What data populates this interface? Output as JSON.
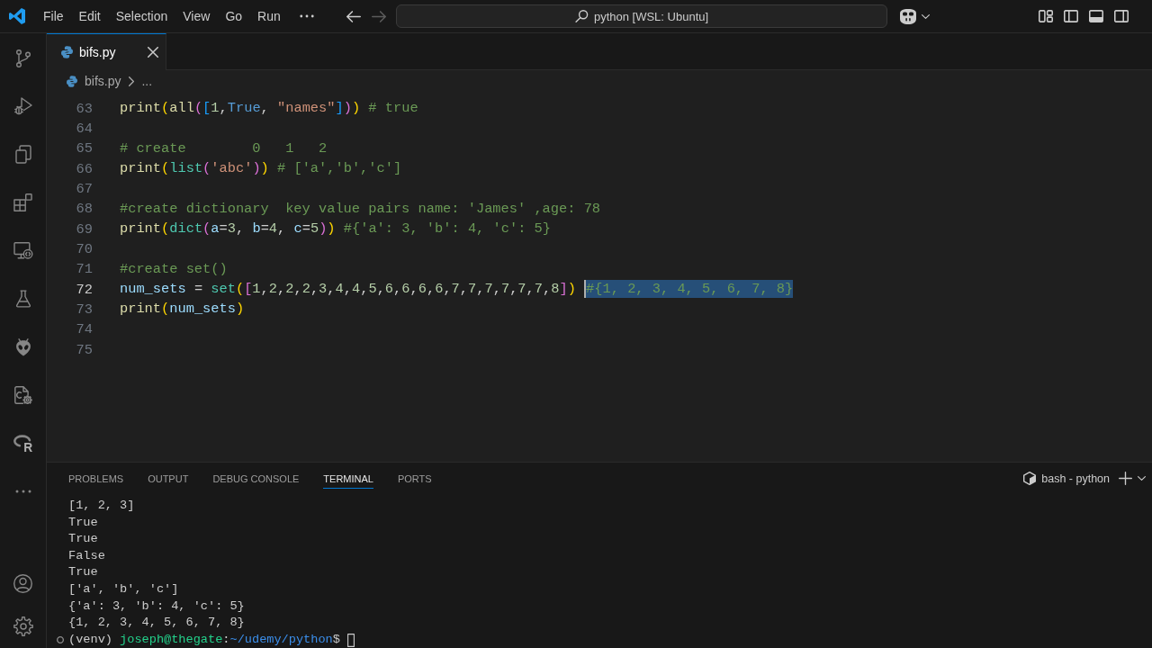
{
  "title_bar": {
    "menu": [
      {
        "label": "File"
      },
      {
        "label": "Edit"
      },
      {
        "label": "Selection"
      },
      {
        "label": "View"
      },
      {
        "label": "Go"
      },
      {
        "label": "Run"
      }
    ],
    "navigation": [
      {
        "kind": "back",
        "disabled": false
      },
      {
        "kind": "forward",
        "disabled": true
      }
    ],
    "command_center": {
      "text": "python [WSL: Ubuntu]"
    },
    "layout_toggles": [
      {
        "kind": "primary_sidebar",
        "on": false
      },
      {
        "kind": "panel",
        "on": true
      },
      {
        "kind": "secondary_sidebar",
        "on": false
      }
    ]
  },
  "activity_bar": {
    "logo_letter": "R"
  },
  "editor": {
    "tabs": [
      {
        "label": "bifs.py",
        "selected": true
      }
    ],
    "breadcrumb": [
      {
        "label": "bifs.py"
      },
      {
        "label": "..."
      }
    ],
    "lines": [
      {
        "number": "63",
        "current": false,
        "tokens": [
          {
            "kind": "function",
            "text": "print"
          },
          {
            "kind": "bracket1",
            "text": "("
          },
          {
            "kind": "function",
            "text": "all"
          },
          {
            "kind": "bracket2",
            "text": "("
          },
          {
            "kind": "bracket3",
            "text": "["
          },
          {
            "kind": "number",
            "text": "1"
          },
          {
            "kind": "text",
            "text": ","
          },
          {
            "kind": "constant",
            "text": "True"
          },
          {
            "kind": "text",
            "text": ", "
          },
          {
            "kind": "string",
            "text": "\"names\""
          },
          {
            "kind": "bracket3",
            "text": "]"
          },
          {
            "kind": "bracket2",
            "text": ")"
          },
          {
            "kind": "bracket1",
            "text": ")"
          },
          {
            "kind": "comment",
            "text": " # true"
          }
        ]
      },
      {
        "number": "64",
        "current": false
      },
      {
        "number": "65",
        "current": false,
        "tokens": [
          {
            "kind": "comment",
            "text": "# create        0   1   2"
          }
        ]
      },
      {
        "number": "66",
        "current": false,
        "tokens": [
          {
            "kind": "function",
            "text": "print"
          },
          {
            "kind": "bracket1",
            "text": "("
          },
          {
            "kind": "class",
            "text": "list"
          },
          {
            "kind": "bracket2",
            "text": "("
          },
          {
            "kind": "string",
            "text": "'abc'"
          },
          {
            "kind": "bracket2",
            "text": ")"
          },
          {
            "kind": "bracket1",
            "text": ")"
          },
          {
            "kind": "comment",
            "text": " # ['a','b','c']"
          }
        ]
      },
      {
        "number": "67",
        "current": false
      },
      {
        "number": "68",
        "current": false,
        "tokens": [
          {
            "kind": "comment",
            "text": "#create dictionary  key value pairs name: 'James' ,age: 78"
          }
        ]
      },
      {
        "number": "69",
        "current": false,
        "tokens": [
          {
            "kind": "function",
            "text": "print"
          },
          {
            "kind": "bracket1",
            "text": "("
          },
          {
            "kind": "class",
            "text": "dict"
          },
          {
            "kind": "bracket2",
            "text": "("
          },
          {
            "kind": "variable",
            "text": "a"
          },
          {
            "kind": "text",
            "text": "="
          },
          {
            "kind": "number",
            "text": "3"
          },
          {
            "kind": "text",
            "text": ", "
          },
          {
            "kind": "variable",
            "text": "b"
          },
          {
            "kind": "text",
            "text": "="
          },
          {
            "kind": "number",
            "text": "4"
          },
          {
            "kind": "text",
            "text": ", "
          },
          {
            "kind": "variable",
            "text": "c"
          },
          {
            "kind": "text",
            "text": "="
          },
          {
            "kind": "number",
            "text": "5"
          },
          {
            "kind": "bracket2",
            "text": ")"
          },
          {
            "kind": "bracket1",
            "text": ")"
          },
          {
            "kind": "comment",
            "text": " #{'a': 3, 'b': 4, 'c': 5}"
          }
        ]
      },
      {
        "number": "70",
        "current": false
      },
      {
        "number": "71",
        "current": false,
        "tokens": [
          {
            "kind": "comment",
            "text": "#create set()"
          }
        ]
      },
      {
        "number": "72",
        "current": true,
        "tokens": [
          {
            "kind": "variable",
            "text": "num_sets"
          },
          {
            "kind": "text",
            "text": " = "
          },
          {
            "kind": "class",
            "text": "set"
          },
          {
            "kind": "bracket1",
            "text": "("
          },
          {
            "kind": "bracket2",
            "text": "["
          },
          {
            "kind": "number",
            "text": "1"
          },
          {
            "kind": "text",
            "text": ","
          },
          {
            "kind": "number",
            "text": "2"
          },
          {
            "kind": "text",
            "text": ","
          },
          {
            "kind": "number",
            "text": "2"
          },
          {
            "kind": "text",
            "text": ","
          },
          {
            "kind": "number",
            "text": "2"
          },
          {
            "kind": "text",
            "text": ","
          },
          {
            "kind": "number",
            "text": "3"
          },
          {
            "kind": "text",
            "text": ","
          },
          {
            "kind": "number",
            "text": "4"
          },
          {
            "kind": "text",
            "text": ","
          },
          {
            "kind": "number",
            "text": "4"
          },
          {
            "kind": "text",
            "text": ","
          },
          {
            "kind": "number",
            "text": "5"
          },
          {
            "kind": "text",
            "text": ","
          },
          {
            "kind": "number",
            "text": "6"
          },
          {
            "kind": "text",
            "text": ","
          },
          {
            "kind": "number",
            "text": "6"
          },
          {
            "kind": "text",
            "text": ","
          },
          {
            "kind": "number",
            "text": "6"
          },
          {
            "kind": "text",
            "text": ","
          },
          {
            "kind": "number",
            "text": "6"
          },
          {
            "kind": "text",
            "text": ","
          },
          {
            "kind": "number",
            "text": "7"
          },
          {
            "kind": "text",
            "text": ","
          },
          {
            "kind": "number",
            "text": "7"
          },
          {
            "kind": "text",
            "text": ","
          },
          {
            "kind": "number",
            "text": "7"
          },
          {
            "kind": "text",
            "text": ","
          },
          {
            "kind": "number",
            "text": "7"
          },
          {
            "kind": "text",
            "text": ","
          },
          {
            "kind": "number",
            "text": "7"
          },
          {
            "kind": "text",
            "text": ","
          },
          {
            "kind": "number",
            "text": "7"
          },
          {
            "kind": "text",
            "text": ","
          },
          {
            "kind": "number",
            "text": "8"
          },
          {
            "kind": "bracket2",
            "text": "]"
          },
          {
            "kind": "bracket1",
            "text": ") "
          },
          {
            "kind": "selection",
            "text": "#{1, 2, 3, 4, 5, 6, 7, 8}"
          }
        ]
      },
      {
        "number": "73",
        "current": false,
        "tokens": [
          {
            "kind": "function",
            "text": "print"
          },
          {
            "kind": "bracket1",
            "text": "("
          },
          {
            "kind": "variable",
            "text": "num_sets"
          },
          {
            "kind": "bracket1",
            "text": ")"
          }
        ]
      },
      {
        "number": "74",
        "current": false
      },
      {
        "number": "75",
        "current": false
      }
    ]
  },
  "panel": {
    "tabs": [
      {
        "label": "PROBLEMS",
        "selected": false
      },
      {
        "label": "OUTPUT",
        "selected": false
      },
      {
        "label": "DEBUG CONSOLE",
        "selected": false
      },
      {
        "label": "TERMINAL",
        "selected": true
      },
      {
        "label": "PORTS",
        "selected": false
      }
    ],
    "terminal_selector": "bash - python",
    "terminal": {
      "output": [
        "[1, 2, 3]",
        "True",
        "True",
        "False",
        "True",
        "['a', 'b', 'c']",
        "{'a': 3, 'b': 4, 'c': 5}",
        "{1, 2, 3, 4, 5, 6, 7, 8}"
      ],
      "prompt": [
        {
          "kind": "plain",
          "text": "(venv) "
        },
        {
          "kind": "user",
          "text": "joseph@thegate"
        },
        {
          "kind": "plain",
          "text": ":"
        },
        {
          "kind": "path",
          "text": "~/udemy/python"
        },
        {
          "kind": "plain",
          "text": "$ "
        }
      ]
    }
  }
}
